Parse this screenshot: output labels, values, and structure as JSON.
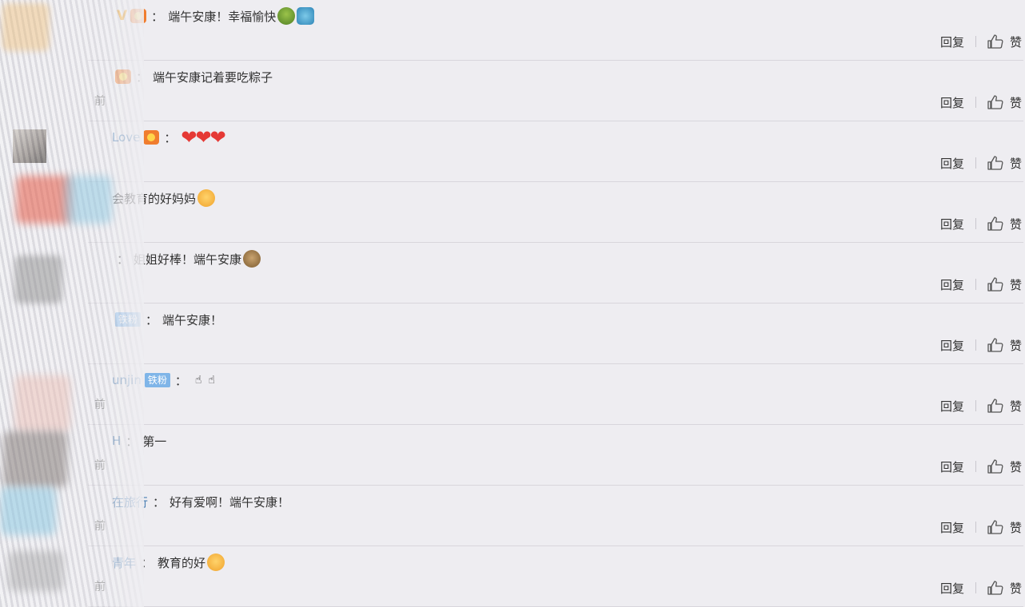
{
  "reply_label": "回复",
  "like_label": "赞",
  "comments": [
    {
      "user": "",
      "vip": "V",
      "fan_badge": true,
      "tag": "",
      "colon": "：",
      "text": "端午安康！幸福愉快",
      "emojis": [
        "zongzi-emoji",
        "dragon-boat-emoji"
      ],
      "hearts": 0,
      "pointers": 0,
      "time": ""
    },
    {
      "user": "",
      "vip": "",
      "fan_badge": true,
      "tag": "",
      "colon": "：",
      "text": "端午安康记着要吃粽子",
      "emojis": [],
      "hearts": 0,
      "pointers": 0,
      "time": "前"
    },
    {
      "user": "Love",
      "vip": "",
      "fan_badge": true,
      "tag": "",
      "colon": "：",
      "text": "",
      "emojis": [],
      "hearts": 3,
      "pointers": 0,
      "time": ""
    },
    {
      "user": "",
      "vip": "",
      "fan_badge": false,
      "tag": "",
      "colon": "",
      "text": "会教育的好妈妈",
      "emojis": [
        "thumbs-up-emoji"
      ],
      "hearts": 0,
      "pointers": 0,
      "time": ""
    },
    {
      "user": "",
      "vip": "",
      "fan_badge": false,
      "tag": "",
      "colon": "：",
      "text": "姐姐好棒！端午安康",
      "emojis": [
        "monkey-emoji"
      ],
      "hearts": 0,
      "pointers": 0,
      "time": ""
    },
    {
      "user": "",
      "vip": "",
      "fan_badge": false,
      "tag": "铁粉",
      "colon": "：",
      "text": "端午安康！",
      "emojis": [],
      "hearts": 0,
      "pointers": 0,
      "time": ""
    },
    {
      "user": "unjin",
      "vip": "",
      "fan_badge": false,
      "tag": "铁粉",
      "colon": "：",
      "text": "",
      "emojis": [],
      "hearts": 0,
      "pointers": 2,
      "time": "前"
    },
    {
      "user": "H",
      "vip": "",
      "fan_badge": false,
      "tag": "",
      "colon": "：",
      "text": "第一",
      "emojis": [],
      "hearts": 0,
      "pointers": 0,
      "time": "前"
    },
    {
      "user": "在旅行",
      "vip": "",
      "fan_badge": false,
      "tag": "",
      "colon": "：",
      "text": "好有爱啊！端午安康！",
      "emojis": [],
      "hearts": 0,
      "pointers": 0,
      "time": "前"
    },
    {
      "user": "青年",
      "vip": "",
      "fan_badge": false,
      "tag": "",
      "colon": "：",
      "text": "教育的好",
      "emojis": [
        "thumbs-up-emoji"
      ],
      "hearts": 0,
      "pointers": 0,
      "time": "前"
    }
  ]
}
